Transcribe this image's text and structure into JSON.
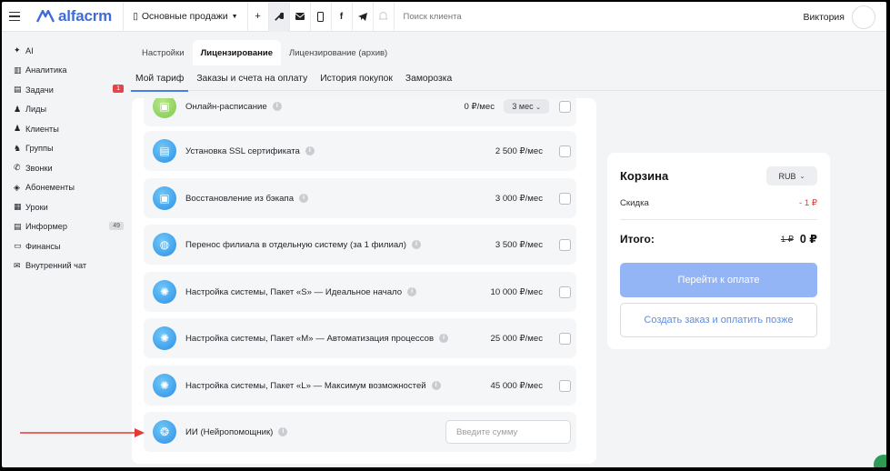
{
  "header": {
    "logo_text": "alfacrm",
    "branch_label": "Основные продажи",
    "search_placeholder": "Поиск клиента",
    "user_name": "Виктория"
  },
  "sidebar": {
    "items": [
      {
        "label": "AI",
        "icon": "sparkle-icon"
      },
      {
        "label": "Аналитика",
        "icon": "chart-icon"
      },
      {
        "label": "Задачи",
        "icon": "clipboard-icon",
        "badge": "1"
      },
      {
        "label": "Лиды",
        "icon": "person-icon"
      },
      {
        "label": "Клиенты",
        "icon": "person-icon"
      },
      {
        "label": "Группы",
        "icon": "group-icon"
      },
      {
        "label": "Звонки",
        "icon": "phone-icon"
      },
      {
        "label": "Абонементы",
        "icon": "ticket-icon"
      },
      {
        "label": "Уроки",
        "icon": "calendar-icon"
      },
      {
        "label": "Информер",
        "icon": "list-icon",
        "badge": "49"
      },
      {
        "label": "Финансы",
        "icon": "money-icon"
      },
      {
        "label": "Внутренний чат",
        "icon": "mail-icon"
      }
    ]
  },
  "tabs_top": [
    "Настройки",
    "Лицензирование",
    "Лицензирование (архив)"
  ],
  "tabs_sub": [
    "Мой тариф",
    "Заказы и счета на оплату",
    "История покупок",
    "Заморозка"
  ],
  "services": [
    {
      "label": "Онлайн-расписание",
      "price": "0 ₽/мес",
      "period": "3 мес",
      "icon": "gift-icon"
    },
    {
      "label": "Установка SSL сертификата",
      "price": "2 500 ₽/мес",
      "icon": "document-icon"
    },
    {
      "label": "Восстановление из бэкапа",
      "price": "3 000 ₽/мес",
      "icon": "archive-icon"
    },
    {
      "label": "Перенос филиала в отдельную систему (за 1 филиал)",
      "price": "3 500 ₽/мес",
      "icon": "globe-icon"
    },
    {
      "label": "Настройка системы, Пакет «S» — Идеальное начало",
      "price": "10 000 ₽/мес",
      "icon": "gear-icon"
    },
    {
      "label": "Настройка системы, Пакет «M» — Автоматизация процессов",
      "price": "25 000 ₽/мес",
      "icon": "gear-icon"
    },
    {
      "label": "Настройка системы, Пакет «L» — Максимум возможностей",
      "price": "45 000 ₽/мес",
      "icon": "gear-icon"
    },
    {
      "label": "ИИ (Нейропомощник)",
      "amount_placeholder": "Введите сумму",
      "icon": "brain-icon"
    }
  ],
  "cart": {
    "title": "Корзина",
    "currency": "RUB",
    "discount_label": "Скидка",
    "discount_value": "- 1 ₽",
    "total_label": "Итого:",
    "total_old": "1 ₽",
    "total_new": "0 ₽",
    "pay_button": "Перейти к оплате",
    "later_button": "Создать заказ и оплатить позже"
  },
  "colors": {
    "accent": "#4b7fe6",
    "pay_button_bg": "#93b5f5",
    "discount": "#e53935",
    "annotation_arrow": "#e53935"
  }
}
